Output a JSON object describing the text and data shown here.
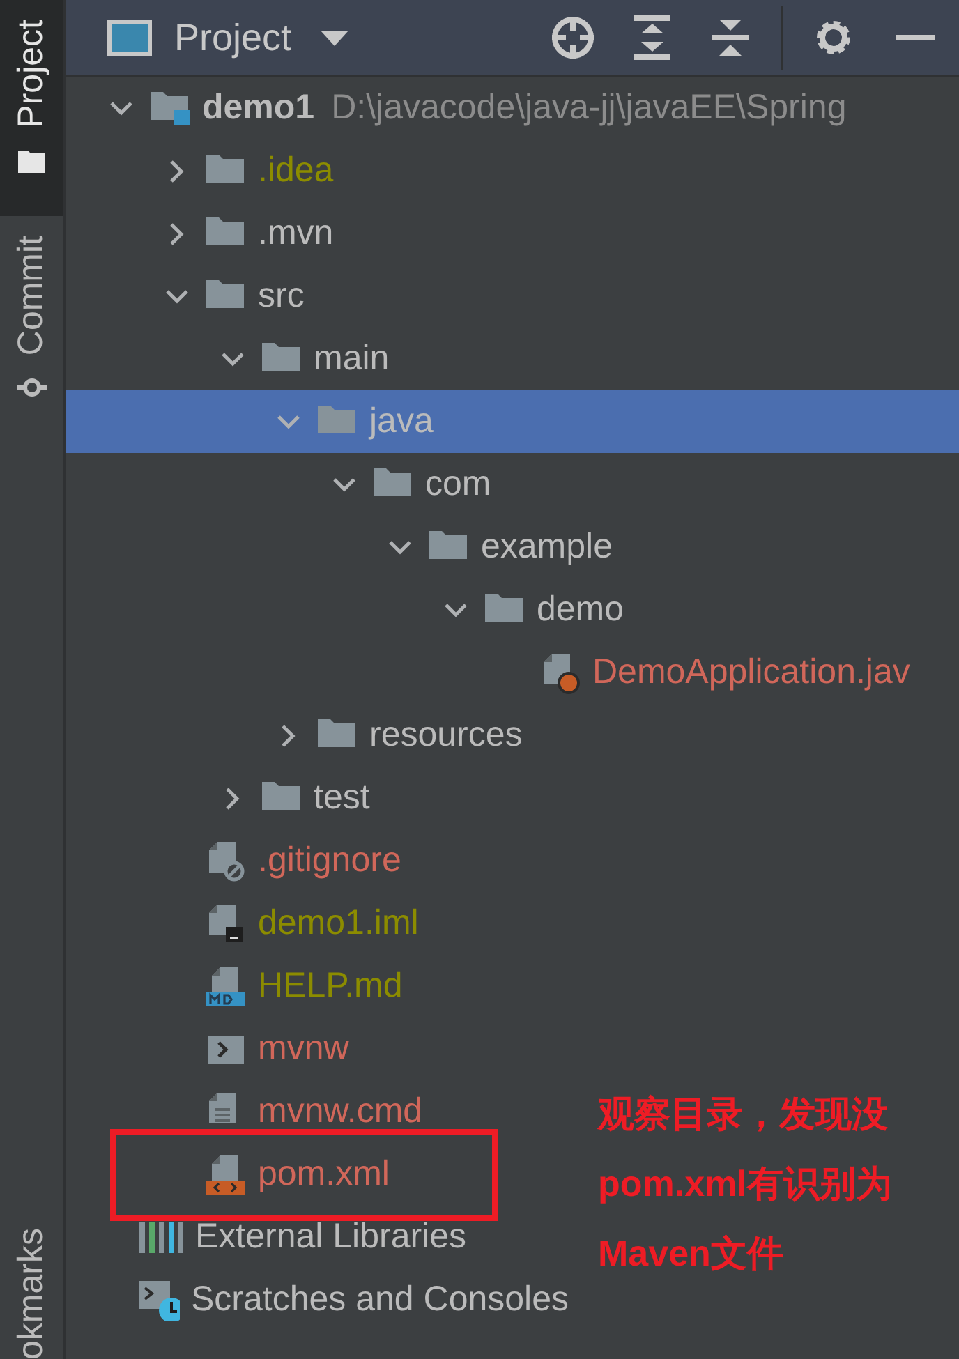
{
  "sidebar": {
    "tabs": [
      {
        "kind": "project",
        "label": "Project",
        "selected": true
      },
      {
        "kind": "commit",
        "label": "Commit",
        "selected": false
      },
      {
        "kind": "bookmarks",
        "label": "okmarks",
        "selected": false
      }
    ]
  },
  "panel": {
    "title": "Project"
  },
  "tree": [
    {
      "kind": "module",
      "label": "demo1",
      "path": "D:\\javacode\\java-jj\\javaEE\\Spring",
      "color": "#bbbbbb",
      "expanded": true,
      "selected": false,
      "children": [
        {
          "kind": "folder",
          "label": ".idea",
          "color": "#8c8c00",
          "expanded": false,
          "selected": false
        },
        {
          "kind": "folder",
          "label": ".mvn",
          "color": "#bbbbbb",
          "expanded": false,
          "selected": false
        },
        {
          "kind": "folder",
          "label": "src",
          "color": "#bbbbbb",
          "expanded": true,
          "selected": false,
          "children": [
            {
              "kind": "folder",
              "label": "main",
              "color": "#bbbbbb",
              "expanded": true,
              "selected": false,
              "children": [
                {
                  "kind": "folder",
                  "label": "java",
                  "color": "#bbbbbb",
                  "expanded": true,
                  "selected": true,
                  "children": [
                    {
                      "kind": "folder",
                      "label": "com",
                      "color": "#bbbbbb",
                      "expanded": true,
                      "selected": false,
                      "children": [
                        {
                          "kind": "folder",
                          "label": "example",
                          "color": "#bbbbbb",
                          "expanded": true,
                          "selected": false,
                          "children": [
                            {
                              "kind": "folder",
                              "label": "demo",
                              "color": "#bbbbbb",
                              "expanded": true,
                              "selected": false,
                              "children": [
                                {
                                  "kind": "java",
                                  "label": "DemoApplication.jav",
                                  "color": "#d1675a",
                                  "selected": false
                                }
                              ]
                            }
                          ]
                        }
                      ]
                    }
                  ]
                },
                {
                  "kind": "folder",
                  "label": "resources",
                  "color": "#bbbbbb",
                  "expanded": false,
                  "selected": false
                }
              ]
            },
            {
              "kind": "folder",
              "label": "test",
              "color": "#bbbbbb",
              "expanded": false,
              "selected": false
            }
          ]
        },
        {
          "kind": "gitignore",
          "label": ".gitignore",
          "color": "#d1675a",
          "selected": false
        },
        {
          "kind": "iml",
          "label": "demo1.iml",
          "color": "#8c8c00",
          "selected": false
        },
        {
          "kind": "markdown",
          "label": "HELP.md",
          "color": "#8c8c00",
          "selected": false
        },
        {
          "kind": "shell",
          "label": "mvnw",
          "color": "#d1675a",
          "selected": false
        },
        {
          "kind": "text",
          "label": "mvnw.cmd",
          "color": "#d1675a",
          "selected": false
        },
        {
          "kind": "xml",
          "label": "pom.xml",
          "color": "#d1675a",
          "selected": false,
          "highlighted": true
        }
      ]
    },
    {
      "kind": "libraries",
      "label": "External Libraries",
      "color": "#bbbbbb",
      "selected": false
    },
    {
      "kind": "scratches",
      "label": "Scratches and Consoles",
      "color": "#bbbbbb",
      "selected": false
    }
  ],
  "annotation": {
    "lines": [
      "观察目录，发现没",
      "pom.xml有识别为",
      "Maven文件"
    ]
  }
}
